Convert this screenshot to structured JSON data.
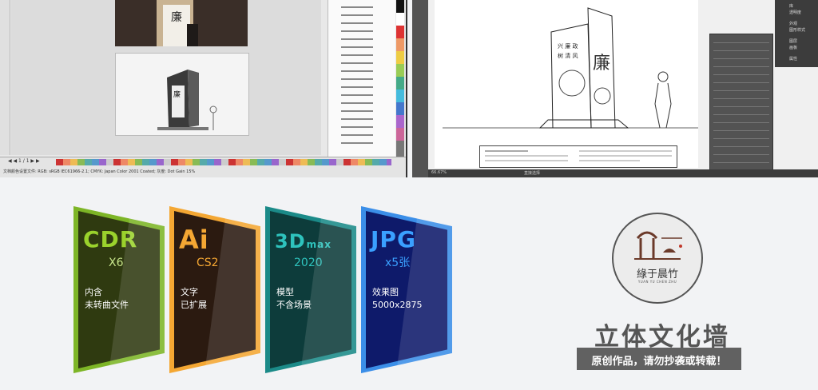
{
  "cards": [
    {
      "id": "cdr",
      "title": "CDR",
      "sub": "X6",
      "desc1": "内含",
      "desc2": "未转曲文件"
    },
    {
      "id": "ai",
      "title": "Ai",
      "sub": "CS2",
      "desc1": "文字",
      "desc2": "已扩展"
    },
    {
      "id": "3d",
      "title": "3D",
      "title_small": "max",
      "sub": "2020",
      "desc1": "模型",
      "desc2": "不含场景"
    },
    {
      "id": "jpg",
      "title": "JPG",
      "sub": "x5张",
      "desc1": "效果图",
      "desc2": "5000x2875"
    }
  ],
  "brand": {
    "name": "綠于晨竹",
    "pinyin": "YUAN YU CHEN ZHU",
    "headline": "立体文化墙",
    "tagline": "原创作品，请勿抄袭或转载！"
  },
  "left_screenshot": {
    "page_nav": "◀ ◀  1 / 1  ▶ ▶",
    "status": "文档颜色设置文件: RGB: sRGB IEC61966-2.1; CMYK: Japan Color 2001 Coated; 灰度: Dot Gain 15%"
  },
  "right_screenshot": {
    "zoom": "66.67%",
    "status_label": "直接选择",
    "menu": [
      "库",
      "透明度",
      "外观",
      "图形样式",
      "图层",
      "画板",
      "属性"
    ]
  },
  "colors": {
    "cdr": "#7db526",
    "ai": "#f4a733",
    "max": "#1b8a88",
    "jpg": "#3b8ee8",
    "headline": "#555555"
  }
}
